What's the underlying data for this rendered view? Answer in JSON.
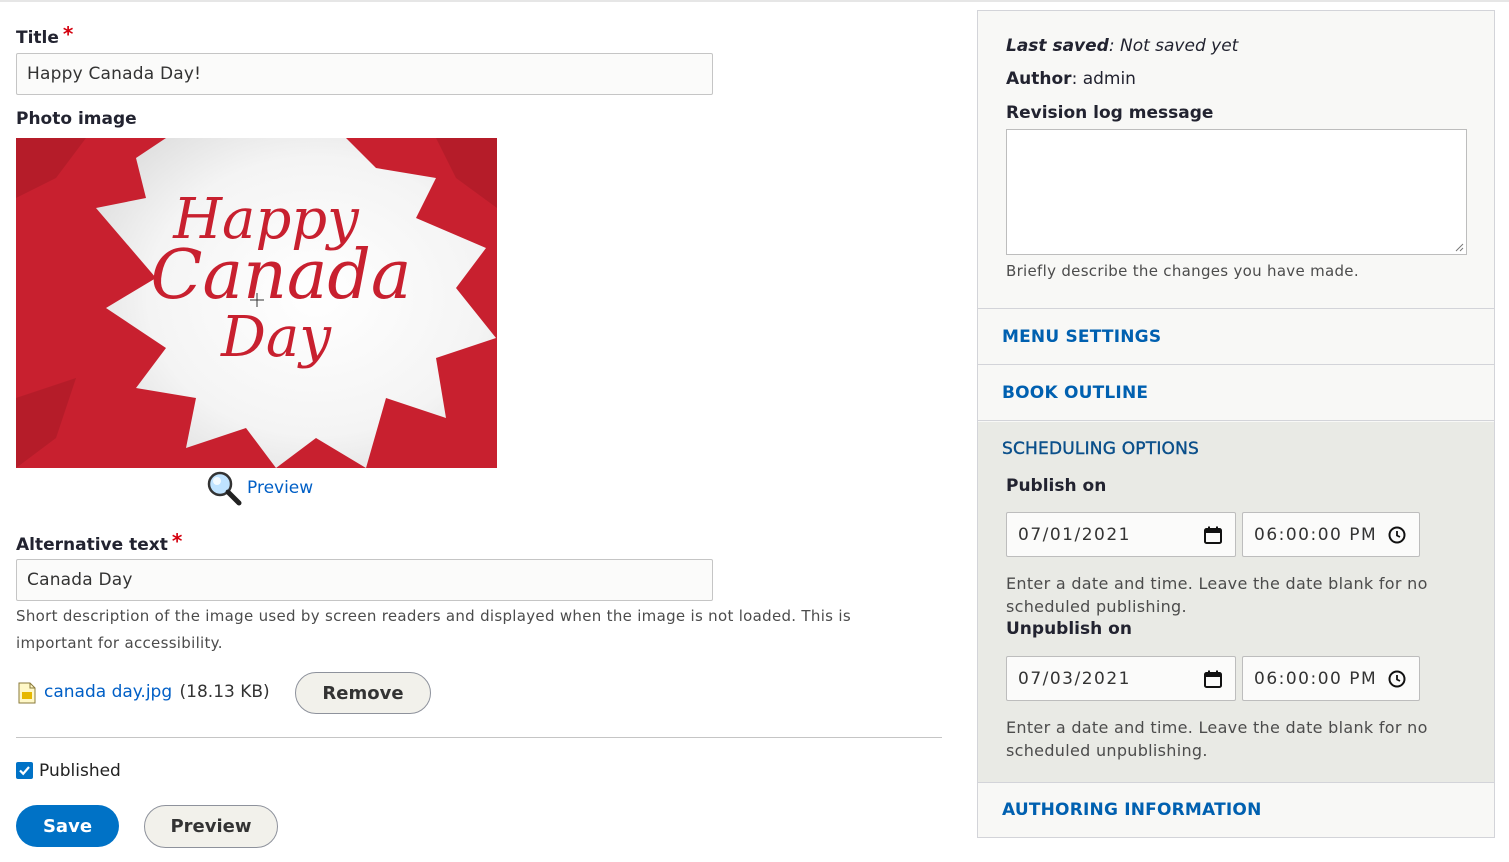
{
  "form": {
    "title_label": "Title",
    "title_value": "Happy Canada Day!",
    "photo_label": "Photo image",
    "image_text": {
      "line1": "Happy",
      "line2": "Canada",
      "line3": "Day"
    },
    "preview_link": "Preview",
    "alt_label": "Alternative text",
    "alt_value": "Canada Day",
    "alt_description": "Short description of the image used by screen readers and displayed when the image is not loaded. This is important for accessibility.",
    "file_name": "canada day.jpg",
    "file_size": "(18.13 KB)",
    "remove_button": "Remove",
    "published_label": "Published",
    "save_button": "Save",
    "preview_button": "Preview"
  },
  "sidebar": {
    "last_saved_label": "Last saved",
    "last_saved_value": ": Not saved yet",
    "author_label": "Author",
    "author_value": ": admin",
    "revision_label": "Revision log message",
    "revision_help": "Briefly describe the changes you have made.",
    "menu_settings": "MENU SETTINGS",
    "book_outline": "BOOK OUTLINE",
    "scheduling": {
      "title": "SCHEDULING OPTIONS",
      "publish_label": "Publish on",
      "publish_date": "07/01/2021",
      "publish_time": "06:00:00 PM",
      "publish_help": "Enter a date and time. Leave the date blank for no scheduled publishing.",
      "unpublish_label": "Unpublish on",
      "unpublish_date": "07/03/2021",
      "unpublish_time": "06:00:00 PM",
      "unpublish_help": "Enter a date and time. Leave the date blank for no scheduled unpublishing."
    },
    "authoring_info": "AUTHORING INFORMATION"
  },
  "colors": {
    "primary": "#0072c6",
    "link": "#005fc6",
    "required": "#d4000e",
    "image_red": "#c8202f"
  },
  "icons": [
    "required-asterisk-icon",
    "magnifier-icon",
    "image-file-icon",
    "calendar-icon",
    "clock-icon",
    "checkbox-checked-icon"
  ]
}
